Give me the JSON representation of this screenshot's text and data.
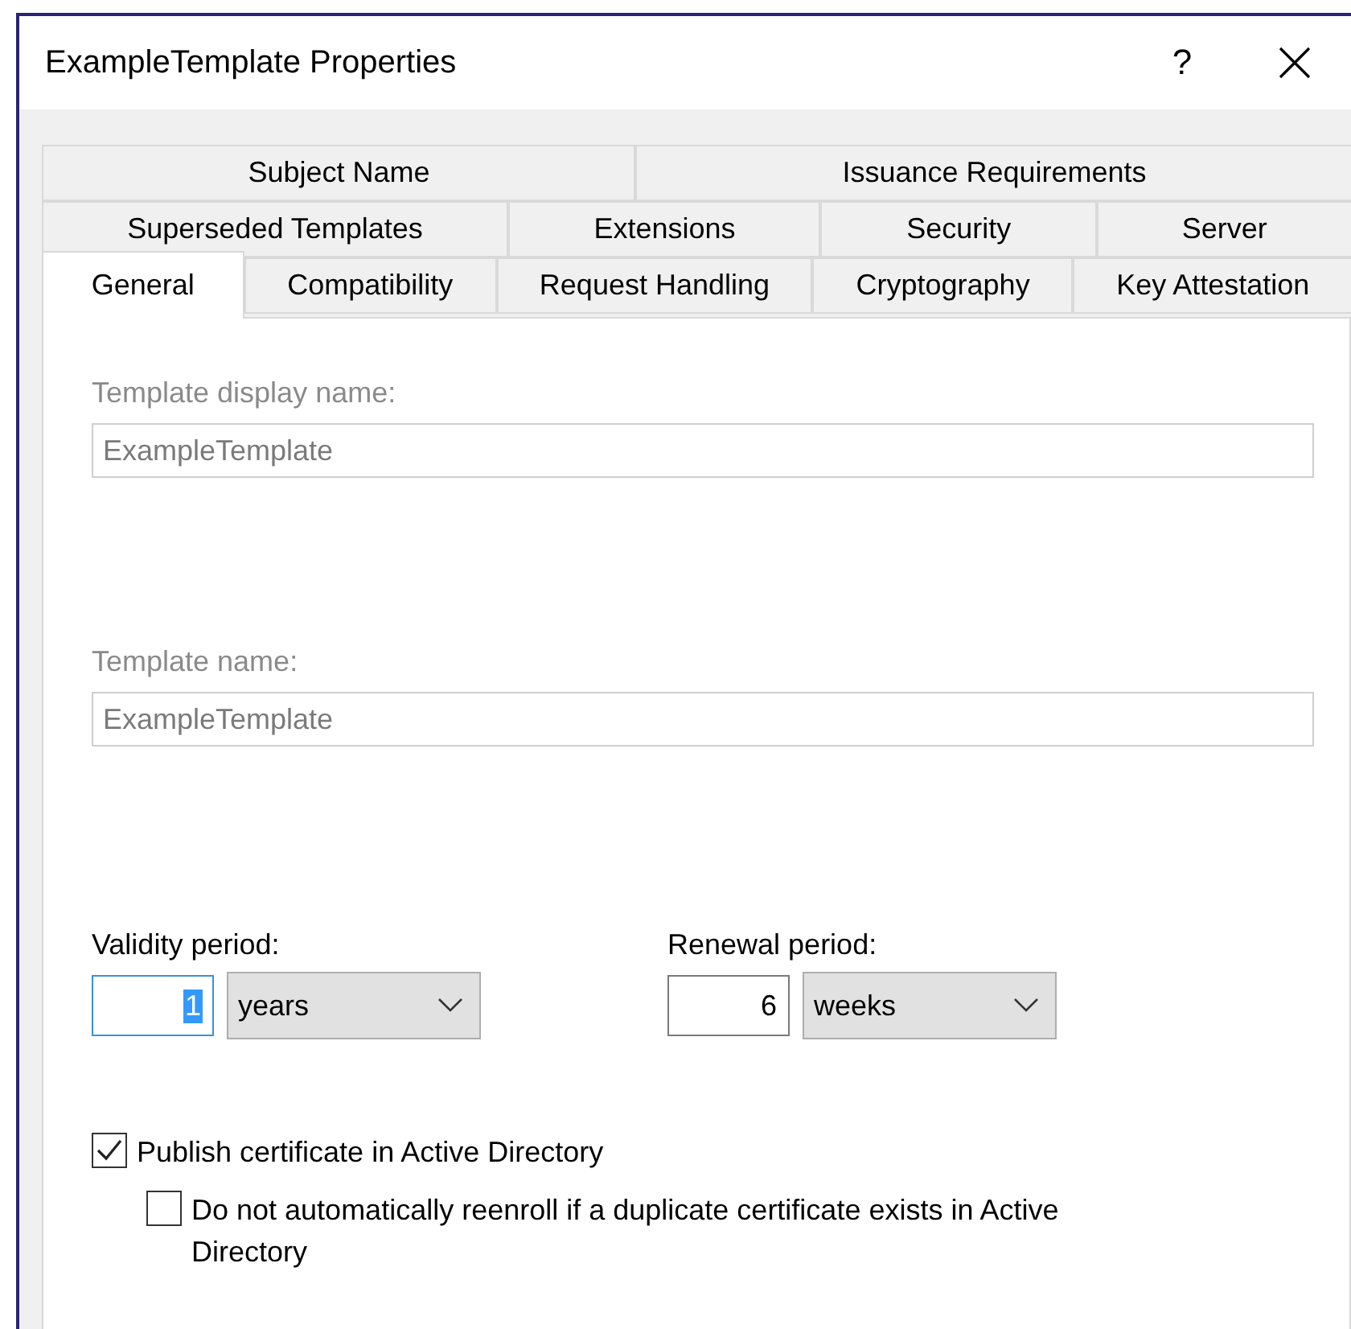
{
  "window": {
    "title": "ExampleTemplate Properties",
    "help": "?"
  },
  "tab_rows": [
    [
      {
        "label": "Subject Name",
        "selected": false
      },
      {
        "label": "Issuance Requirements",
        "selected": false
      }
    ],
    [
      {
        "label": "Superseded Templates",
        "selected": false
      },
      {
        "label": "Extensions",
        "selected": false
      },
      {
        "label": "Security",
        "selected": false
      },
      {
        "label": "Server",
        "selected": false
      }
    ],
    [
      {
        "label": "General",
        "selected": true
      },
      {
        "label": "Compatibility",
        "selected": false
      },
      {
        "label": "Request Handling",
        "selected": false
      },
      {
        "label": "Cryptography",
        "selected": false
      },
      {
        "label": "Key Attestation",
        "selected": false
      }
    ]
  ],
  "fields": [
    {
      "label": "Template display name:",
      "value": "ExampleTemplate",
      "disabled": true
    },
    {
      "label": "Template name:",
      "value": "ExampleTemplate",
      "disabled": true
    }
  ],
  "periods": [
    {
      "label": "Validity period:",
      "number": "1",
      "unit": "years",
      "focused": true
    },
    {
      "label": "Renewal period:",
      "number": "6",
      "unit": "weeks",
      "focused": false
    }
  ],
  "checkboxes": [
    {
      "label": "Publish certificate in Active Directory",
      "checked": true,
      "indented": false
    },
    {
      "label": "Do not automatically reenroll if a duplicate certificate exists in Active Directory",
      "checked": false,
      "indented": true
    }
  ]
}
